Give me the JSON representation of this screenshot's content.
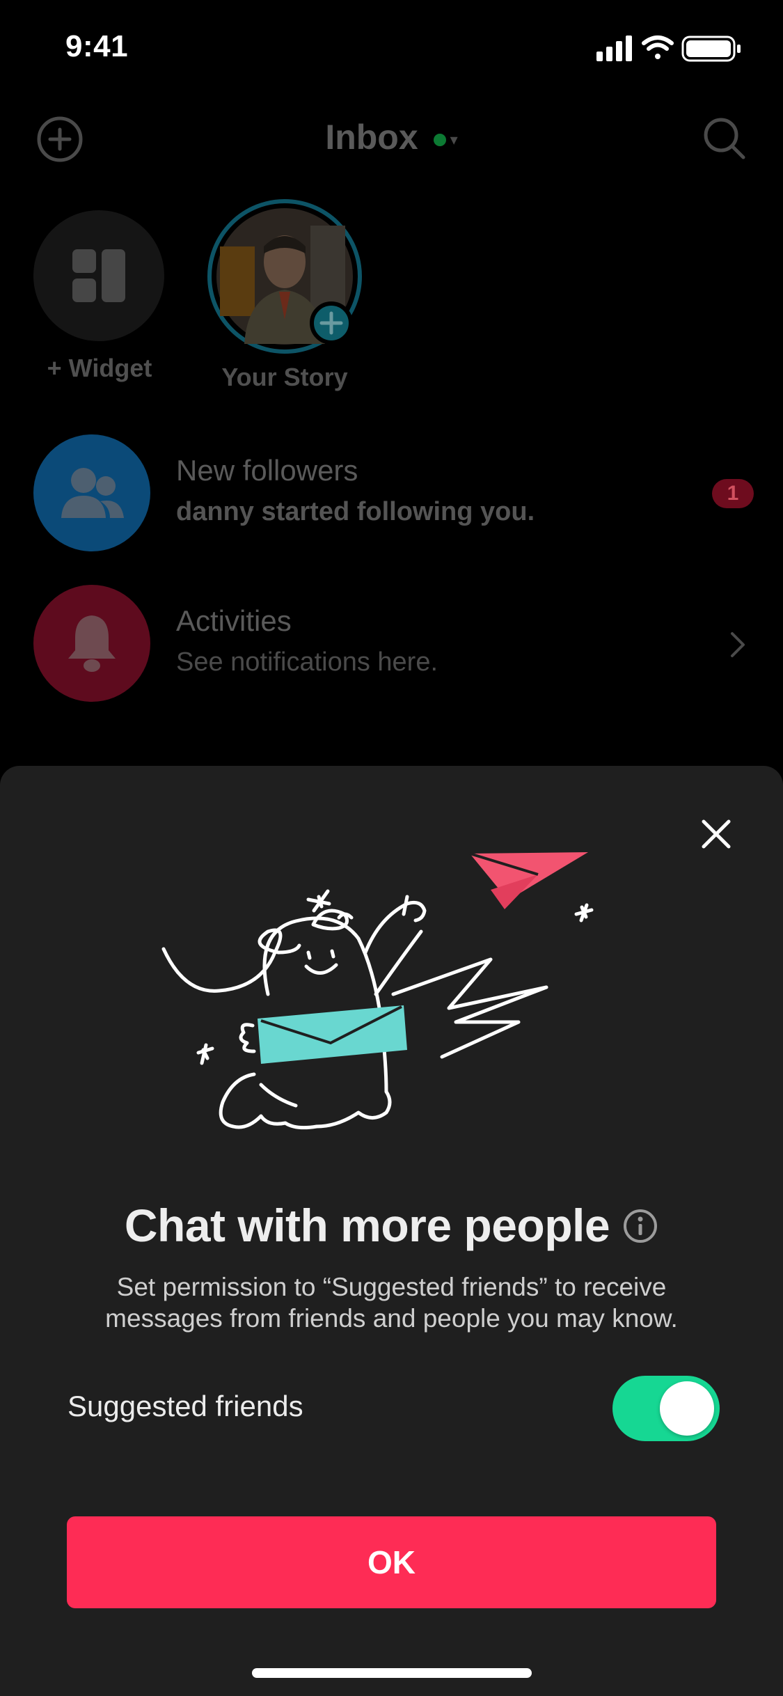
{
  "status_bar": {
    "time": "9:41"
  },
  "inbox": {
    "title": "Inbox",
    "stories": [
      {
        "label": "+ Widget",
        "icon": "widget-icon"
      },
      {
        "label": "Your Story",
        "icon": "avatar"
      }
    ],
    "rows": [
      {
        "title": "New followers",
        "subtitle": "danny started following you.",
        "badge": "1",
        "icon": "followers-icon",
        "color": "#0b4a78"
      },
      {
        "title": "Activities",
        "subtitle": "See notifications here.",
        "icon": "bell-icon",
        "color": "#5e0b1e"
      }
    ]
  },
  "sheet": {
    "title": "Chat with more people",
    "description": "Set permission to “Suggested friends” to receive messages from friends and people you may know.",
    "toggle": {
      "label": "Suggested friends",
      "on": true
    },
    "ok_label": "OK"
  },
  "colors": {
    "accent": "#fe2c55",
    "toggle_on": "#16d793",
    "sheet_bg": "#1f1f1f"
  }
}
